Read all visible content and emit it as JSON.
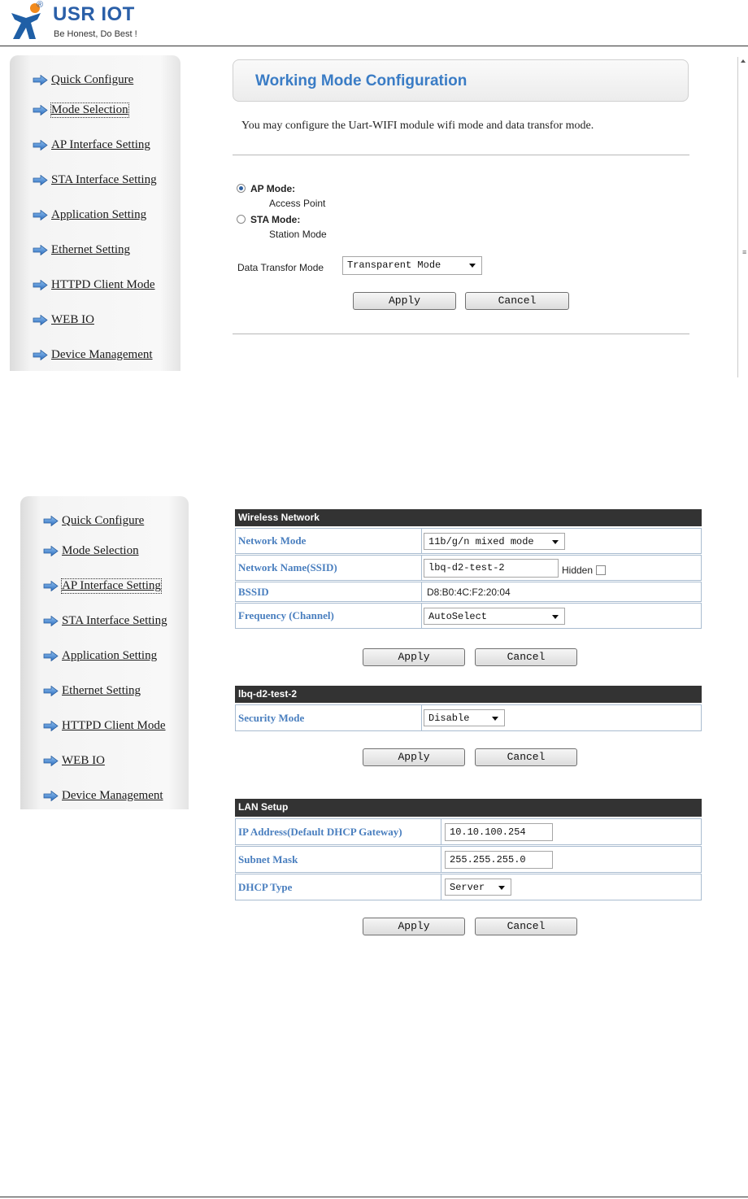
{
  "header": {
    "brand": "USR IOT",
    "registered": "®",
    "tagline": "Be Honest, Do Best !"
  },
  "sidebar_top": {
    "items": [
      {
        "label": "Quick Configure"
      },
      {
        "label": "Mode Selection",
        "active": true
      },
      {
        "label": "AP Interface Setting"
      },
      {
        "label": "STA Interface Setting"
      },
      {
        "label": "Application Setting"
      },
      {
        "label": "Ethernet Setting"
      },
      {
        "label": "HTTPD Client Mode"
      },
      {
        "label": "WEB IO"
      },
      {
        "label": "Device Management"
      }
    ]
  },
  "working_mode": {
    "title": "Working Mode Configuration",
    "description": "You may configure the Uart-WIFI module wifi mode and data transfor mode.",
    "ap_mode": {
      "label": "AP Mode:",
      "sub": "Access Point",
      "selected": true
    },
    "sta_mode": {
      "label": "STA Mode:",
      "sub": "Station Mode",
      "selected": false
    },
    "data_transfor": {
      "label": "Data Transfor Mode",
      "value": "Transparent Mode"
    },
    "apply": "Apply",
    "cancel": "Cancel"
  },
  "sidebar_bottom": {
    "items": [
      {
        "label": "Quick Configure"
      },
      {
        "label": "Mode Selection"
      },
      {
        "label": "AP Interface Setting",
        "active": true
      },
      {
        "label": "STA Interface Setting"
      },
      {
        "label": "Application Setting"
      },
      {
        "label": "Ethernet Setting"
      },
      {
        "label": "HTTPD Client Mode"
      },
      {
        "label": "WEB IO"
      },
      {
        "label": "Device Management"
      }
    ]
  },
  "wireless": {
    "header": "Wireless Network",
    "network_mode": {
      "label": "Network Mode",
      "value": "11b/g/n mixed mode"
    },
    "ssid": {
      "label": "Network Name(SSID)",
      "value": "lbq-d2-test-2",
      "hidden_label": "Hidden"
    },
    "bssid": {
      "label": "BSSID",
      "value": "D8:B0:4C:F2:20:04"
    },
    "frequency": {
      "label": "Frequency (Channel)",
      "value": "AutoSelect"
    },
    "apply": "Apply",
    "cancel": "Cancel"
  },
  "security": {
    "header": "lbq-d2-test-2",
    "mode": {
      "label": "Security Mode",
      "value": "Disable"
    },
    "apply": "Apply",
    "cancel": "Cancel"
  },
  "lan": {
    "header": "LAN Setup",
    "ip": {
      "label": "IP Address(Default DHCP Gateway)",
      "value": "10.10.100.254"
    },
    "mask": {
      "label": "Subnet Mask",
      "value": "255.255.255.0"
    },
    "dhcp": {
      "label": "DHCP Type",
      "value": "Server"
    },
    "apply": "Apply",
    "cancel": "Cancel"
  }
}
